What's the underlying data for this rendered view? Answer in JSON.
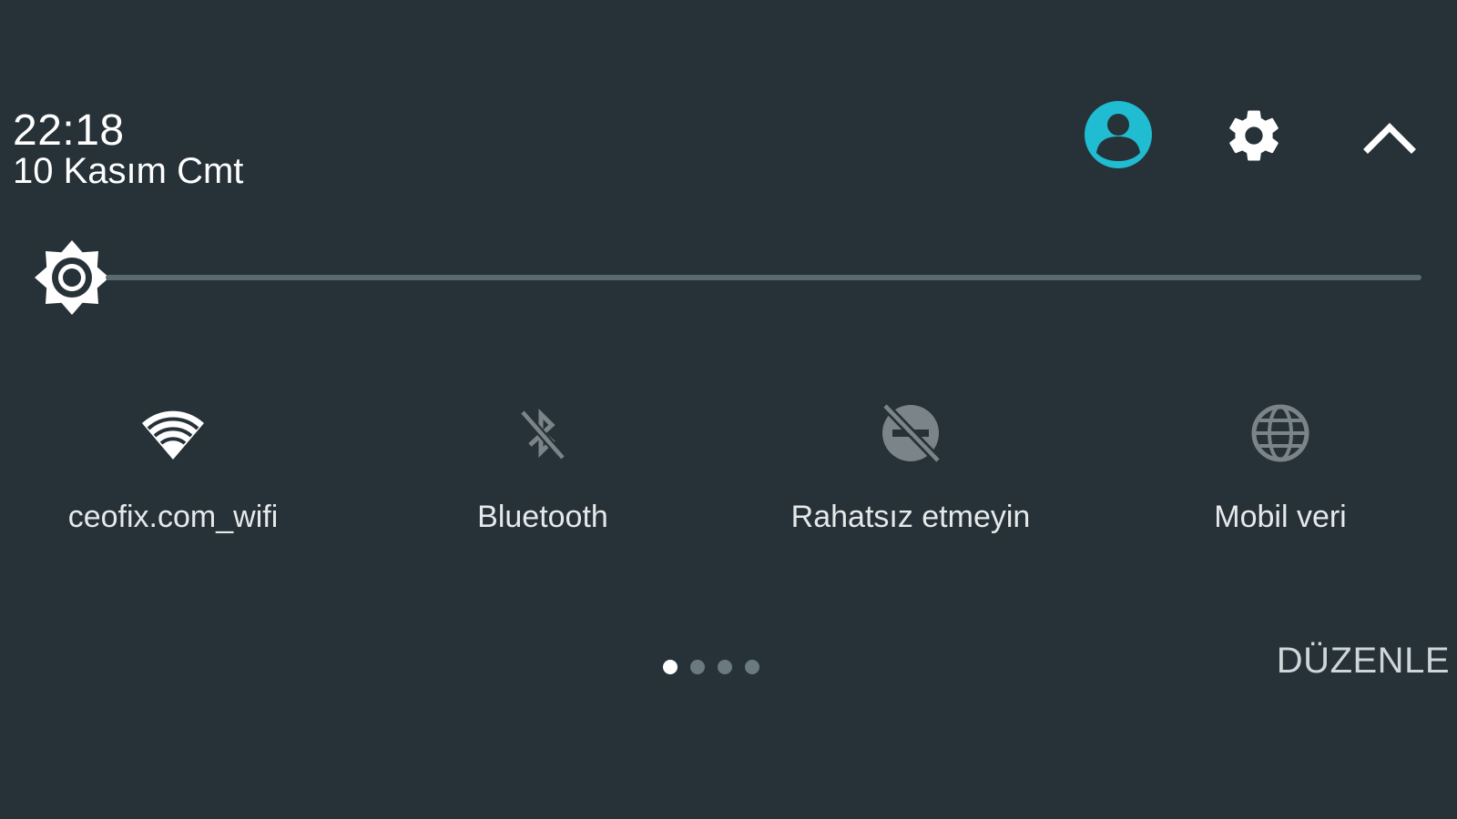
{
  "header": {
    "time": "22:18",
    "date": "10 Kasım Cmt",
    "avatar_color": "#1fbcd2"
  },
  "brightness": {
    "level": 0.0
  },
  "tiles": [
    {
      "label": "ceofix.com_wifi",
      "icon": "wifi-icon",
      "active": true
    },
    {
      "label": "Bluetooth",
      "icon": "bluetooth-off-icon",
      "active": false
    },
    {
      "label": "Rahatsız etmeyin",
      "icon": "do-not-disturb-off-icon",
      "active": false
    },
    {
      "label": "Mobil veri",
      "icon": "globe-icon",
      "active": false
    }
  ],
  "pager": {
    "pages": 4,
    "current": 1
  },
  "footer": {
    "edit_label": "DÜZENLE"
  },
  "colors": {
    "background": "#263238",
    "accent": "#1fbcd2",
    "inactive_icon": "#7b8589",
    "track": "#5a6a72"
  }
}
